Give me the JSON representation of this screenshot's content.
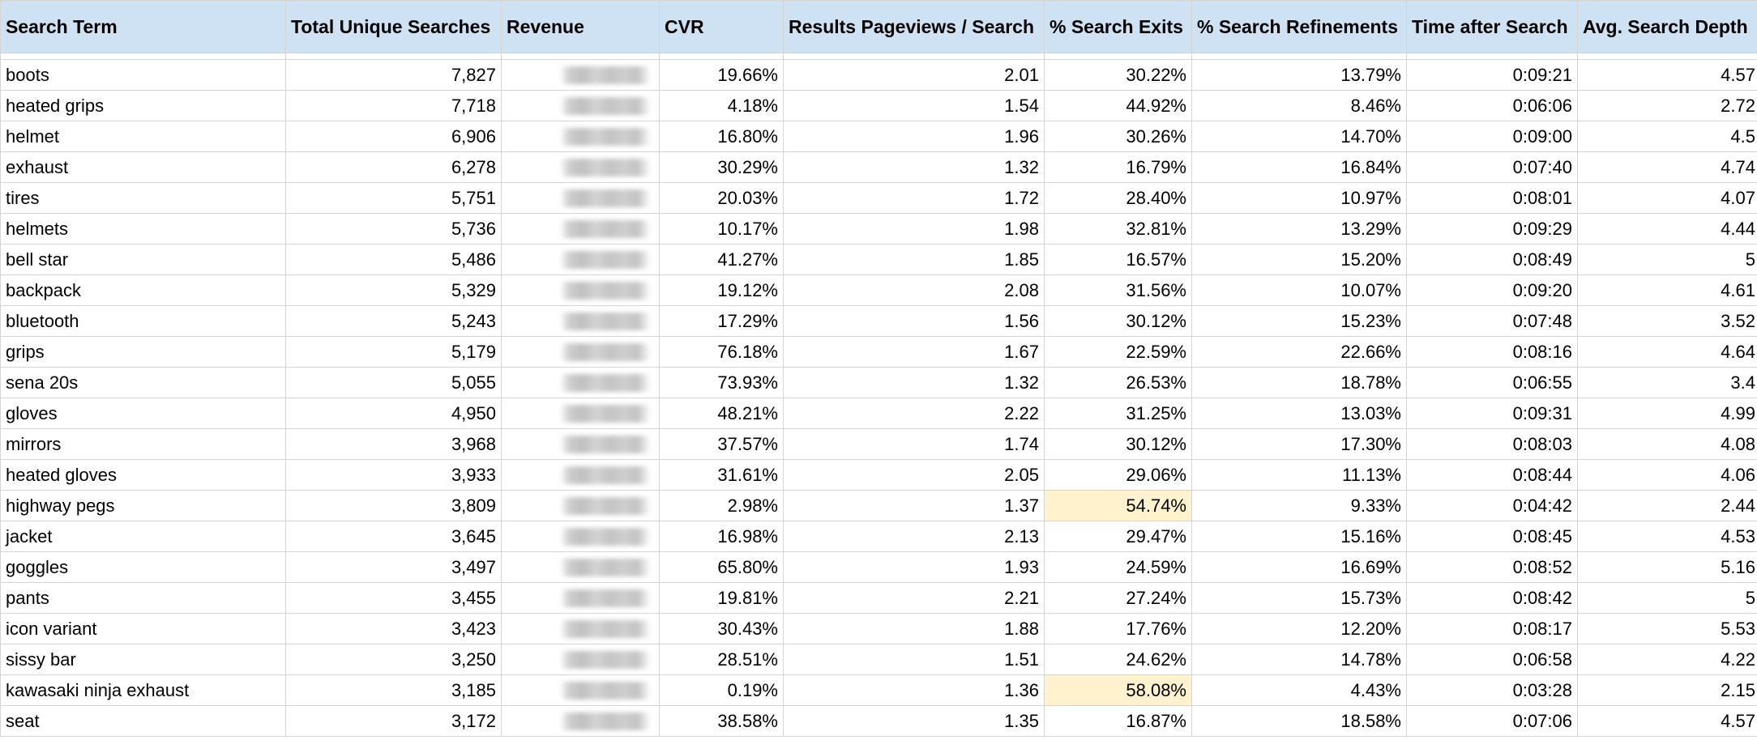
{
  "headers": {
    "term": "Search Term",
    "unique": "Total Unique Searches",
    "revenue": "Revenue",
    "cvr": "CVR",
    "rpp": "Results Pageviews / Search",
    "exits": "% Search Exits",
    "refinements": "% Search Refinements",
    "time": "Time after Search",
    "depth": "Avg. Search Depth"
  },
  "colors": {
    "header_bg": "#cfe2f3",
    "highlight_bg": "#fff2cc"
  },
  "rows": [
    {
      "term": "boots",
      "unique": "7,827",
      "cvr": "19.66%",
      "rpp": "2.01",
      "exits": "30.22%",
      "refinements": "13.79%",
      "time": "0:09:21",
      "depth": "4.57",
      "highlight_exits": false
    },
    {
      "term": "heated grips",
      "unique": "7,718",
      "cvr": "4.18%",
      "rpp": "1.54",
      "exits": "44.92%",
      "refinements": "8.46%",
      "time": "0:06:06",
      "depth": "2.72",
      "highlight_exits": false
    },
    {
      "term": "helmet",
      "unique": "6,906",
      "cvr": "16.80%",
      "rpp": "1.96",
      "exits": "30.26%",
      "refinements": "14.70%",
      "time": "0:09:00",
      "depth": "4.5",
      "highlight_exits": false
    },
    {
      "term": "exhaust",
      "unique": "6,278",
      "cvr": "30.29%",
      "rpp": "1.32",
      "exits": "16.79%",
      "refinements": "16.84%",
      "time": "0:07:40",
      "depth": "4.74",
      "highlight_exits": false
    },
    {
      "term": "tires",
      "unique": "5,751",
      "cvr": "20.03%",
      "rpp": "1.72",
      "exits": "28.40%",
      "refinements": "10.97%",
      "time": "0:08:01",
      "depth": "4.07",
      "highlight_exits": false
    },
    {
      "term": "helmets",
      "unique": "5,736",
      "cvr": "10.17%",
      "rpp": "1.98",
      "exits": "32.81%",
      "refinements": "13.29%",
      "time": "0:09:29",
      "depth": "4.44",
      "highlight_exits": false
    },
    {
      "term": "bell star",
      "unique": "5,486",
      "cvr": "41.27%",
      "rpp": "1.85",
      "exits": "16.57%",
      "refinements": "15.20%",
      "time": "0:08:49",
      "depth": "5",
      "highlight_exits": false
    },
    {
      "term": "backpack",
      "unique": "5,329",
      "cvr": "19.12%",
      "rpp": "2.08",
      "exits": "31.56%",
      "refinements": "10.07%",
      "time": "0:09:20",
      "depth": "4.61",
      "highlight_exits": false
    },
    {
      "term": "bluetooth",
      "unique": "5,243",
      "cvr": "17.29%",
      "rpp": "1.56",
      "exits": "30.12%",
      "refinements": "15.23%",
      "time": "0:07:48",
      "depth": "3.52",
      "highlight_exits": false
    },
    {
      "term": "grips",
      "unique": "5,179",
      "cvr": "76.18%",
      "rpp": "1.67",
      "exits": "22.59%",
      "refinements": "22.66%",
      "time": "0:08:16",
      "depth": "4.64",
      "highlight_exits": false
    },
    {
      "term": "sena 20s",
      "unique": "5,055",
      "cvr": "73.93%",
      "rpp": "1.32",
      "exits": "26.53%",
      "refinements": "18.78%",
      "time": "0:06:55",
      "depth": "3.4",
      "highlight_exits": false
    },
    {
      "term": "gloves",
      "unique": "4,950",
      "cvr": "48.21%",
      "rpp": "2.22",
      "exits": "31.25%",
      "refinements": "13.03%",
      "time": "0:09:31",
      "depth": "4.99",
      "highlight_exits": false
    },
    {
      "term": "mirrors",
      "unique": "3,968",
      "cvr": "37.57%",
      "rpp": "1.74",
      "exits": "30.12%",
      "refinements": "17.30%",
      "time": "0:08:03",
      "depth": "4.08",
      "highlight_exits": false
    },
    {
      "term": "heated gloves",
      "unique": "3,933",
      "cvr": "31.61%",
      "rpp": "2.05",
      "exits": "29.06%",
      "refinements": "11.13%",
      "time": "0:08:44",
      "depth": "4.06",
      "highlight_exits": false
    },
    {
      "term": "highway pegs",
      "unique": "3,809",
      "cvr": "2.98%",
      "rpp": "1.37",
      "exits": "54.74%",
      "refinements": "9.33%",
      "time": "0:04:42",
      "depth": "2.44",
      "highlight_exits": true
    },
    {
      "term": "jacket",
      "unique": "3,645",
      "cvr": "16.98%",
      "rpp": "2.13",
      "exits": "29.47%",
      "refinements": "15.16%",
      "time": "0:08:45",
      "depth": "4.53",
      "highlight_exits": false
    },
    {
      "term": "goggles",
      "unique": "3,497",
      "cvr": "65.80%",
      "rpp": "1.93",
      "exits": "24.59%",
      "refinements": "16.69%",
      "time": "0:08:52",
      "depth": "5.16",
      "highlight_exits": false
    },
    {
      "term": "pants",
      "unique": "3,455",
      "cvr": "19.81%",
      "rpp": "2.21",
      "exits": "27.24%",
      "refinements": "15.73%",
      "time": "0:08:42",
      "depth": "5",
      "highlight_exits": false
    },
    {
      "term": "icon variant",
      "unique": "3,423",
      "cvr": "30.43%",
      "rpp": "1.88",
      "exits": "17.76%",
      "refinements": "12.20%",
      "time": "0:08:17",
      "depth": "5.53",
      "highlight_exits": false
    },
    {
      "term": "sissy bar",
      "unique": "3,250",
      "cvr": "28.51%",
      "rpp": "1.51",
      "exits": "24.62%",
      "refinements": "14.78%",
      "time": "0:06:58",
      "depth": "4.22",
      "highlight_exits": false
    },
    {
      "term": "kawasaki ninja exhaust",
      "unique": "3,185",
      "cvr": "0.19%",
      "rpp": "1.36",
      "exits": "58.08%",
      "refinements": "4.43%",
      "time": "0:03:28",
      "depth": "2.15",
      "highlight_exits": true
    },
    {
      "term": "seat",
      "unique": "3,172",
      "cvr": "38.58%",
      "rpp": "1.35",
      "exits": "16.87%",
      "refinements": "18.58%",
      "time": "0:07:06",
      "depth": "4.57",
      "highlight_exits": false
    }
  ]
}
